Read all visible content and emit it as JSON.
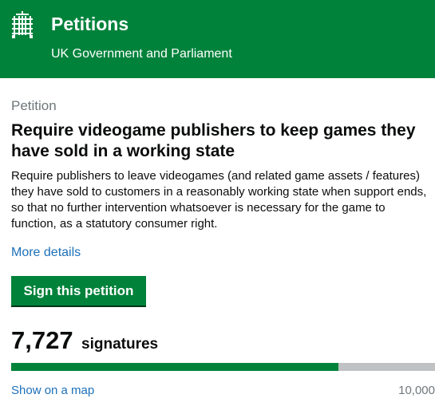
{
  "header": {
    "title": "Petitions",
    "subtitle": "UK Government and Parliament",
    "crest_icon": "portcullis-icon",
    "background_color": "#00823b"
  },
  "petition": {
    "caption": "Petition",
    "title": "Require videogame publishers to keep games they have sold in a working state",
    "summary": "Require publishers to leave videogames (and related game assets / features) they have sold to customers in a reasonably working state when support ends, so that no further intervention whatsoever is necessary for the game to function, as a statutory consumer right.",
    "more_details_label": "More details",
    "sign_button_label": "Sign this petition"
  },
  "signatures": {
    "count": "7,727",
    "label": "signatures",
    "target": "10,000",
    "progress_fraction": 0.7727,
    "progress_color": "#00823b",
    "track_color": "#bfc1c3"
  },
  "links": {
    "map_label": "Show on a map"
  }
}
